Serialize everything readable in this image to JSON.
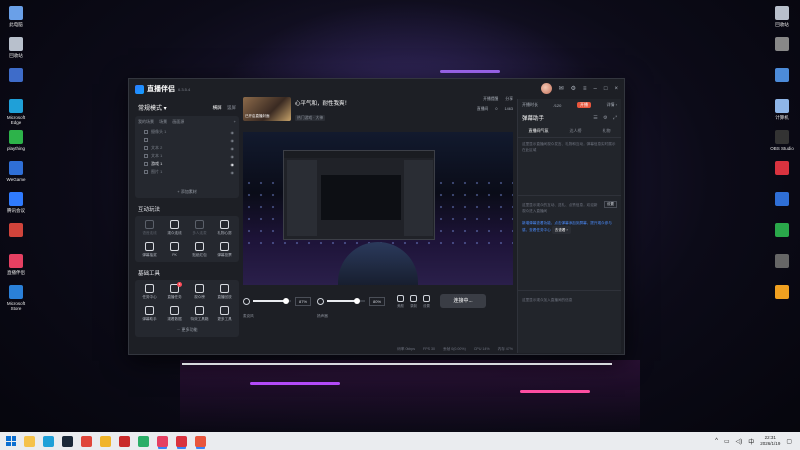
{
  "desktop": {
    "icons_left": [
      {
        "label": "此电脑",
        "color": "#6aa0e8"
      },
      {
        "label": "回收站",
        "color": "#b8c0cc"
      },
      {
        "label": "",
        "color": "#3e6cc9"
      },
      {
        "label": "Microsoft Edge",
        "color": "#1fa0d8"
      },
      {
        "label": "plaything",
        "color": "#2db34a"
      },
      {
        "label": "WeGame",
        "color": "#2f6fd6"
      },
      {
        "label": "腾讯会议",
        "color": "#2f7bff"
      },
      {
        "label": "",
        "color": "#d0443b"
      },
      {
        "label": "直播伴侣",
        "color": "#e54062"
      },
      {
        "label": "Microsoft Store",
        "color": "#2a80d8"
      }
    ],
    "icons_right": [
      {
        "label": "回收站",
        "color": "#b8c0cc"
      },
      {
        "label": "",
        "color": "#888"
      },
      {
        "label": "",
        "color": "#4c8bd9"
      },
      {
        "label": "计算机",
        "color": "#8fb6e8"
      },
      {
        "label": "OBS Studio",
        "color": "#333"
      },
      {
        "label": "",
        "color": "#d9333f"
      },
      {
        "label": "",
        "color": "#2f6fd6"
      },
      {
        "label": "",
        "color": "#2aa84a"
      },
      {
        "label": "",
        "color": "#666"
      },
      {
        "label": "",
        "color": "#f0a020"
      }
    ]
  },
  "app": {
    "name": "直播伴侣",
    "version": "6.3.5.4"
  },
  "left_panel": {
    "mode_title": "常规模式 ▾",
    "mode_tabs": [
      "横屏",
      "竖屏"
    ],
    "scene_tabs": [
      "我的场景",
      "场景",
      "画面源"
    ],
    "sources": [
      "摄像头 1",
      "",
      "文本 2",
      "文本 1",
      "游戏 1",
      "图片 1"
    ],
    "add_source": "+ 添加素材",
    "interact_title": "互动玩法",
    "interact_tools": [
      {
        "label": "语音连线",
        "dim": true
      },
      {
        "label": "观众连线",
        "dim": false
      },
      {
        "label": "多人连麦",
        "dim": true
      },
      {
        "label": "礼物心愿",
        "dim": false
      },
      {
        "label": "弹幕抽奖",
        "dim": false
      },
      {
        "label": "PK",
        "dim": false
      },
      {
        "label": "贴纸红包",
        "dim": false
      },
      {
        "label": "弹幕投票",
        "dim": false
      }
    ],
    "basic_title": "基础工具",
    "basic_tools": [
      {
        "label": "任务中心",
        "badge": ""
      },
      {
        "label": "直播任务",
        "badge": "1"
      },
      {
        "label": "观众榜",
        "badge": ""
      },
      {
        "label": "直播回放",
        "badge": ""
      },
      {
        "label": "弹幕助手",
        "badge": ""
      },
      {
        "label": "观看数据",
        "badge": ""
      },
      {
        "label": "特效工具箱",
        "badge": ""
      },
      {
        "label": "更多工具",
        "badge": ""
      }
    ],
    "more": "··· 更多功能"
  },
  "center": {
    "cover_text": "已开启直播封面",
    "stream_title": "心平气和，耐性我爽！",
    "category": "热门游戏 · 大神",
    "side_top": [
      "开播提醒",
      "分享"
    ],
    "side_bottom": [
      "直播间",
      "0",
      "1463"
    ],
    "audio": {
      "mic_label": "麦克风",
      "mic_pct": "87%",
      "mic_level": 0.87,
      "spk_label": "扬声器",
      "spk_pct": "80%",
      "spk_level": 0.8,
      "mini_buttons": [
        "美颜",
        "录制",
        "设置"
      ],
      "go_button": "连接中..."
    },
    "status": [
      "码率 0kbps",
      "FPS 30",
      "丢帧 0(0.00%)",
      "CPU 14%",
      "内存 47%"
    ]
  },
  "titlebar": {
    "right_items": [
      "开播时长",
      "/120",
      "开播",
      "详情 ›"
    ]
  },
  "right_panel": {
    "title": "弹幕助手",
    "tabs": [
      "直播间气氛",
      "达人榜",
      "礼物"
    ],
    "text1": "这里显示直播间观众发言、礼物和互动，弹幕信息实时展示在此区域",
    "text2": "这里显示观众的互动、送礼、点赞信息，欢迎新观众进入直播间",
    "small_btn": "设置",
    "blue_text": "新增弹幕查看功能，点击弹幕添加到屏幕，提升观众参与感，查看任务中心",
    "cta": "去查看 ›",
    "bottom_text": "这里显示观众加入直播间的信息"
  },
  "taskbar": {
    "apps": [
      {
        "name": "file-explorer",
        "color": "#f5c24a"
      },
      {
        "name": "edge",
        "color": "#1fa0d8"
      },
      {
        "name": "steam",
        "color": "#1b2838"
      },
      {
        "name": "chrome",
        "color": "#e0463a"
      },
      {
        "name": "app-yellow",
        "color": "#f0b429"
      },
      {
        "name": "app-red",
        "color": "#c92a2a"
      },
      {
        "name": "wechat",
        "color": "#2aae67"
      },
      {
        "name": "douyin-live",
        "color": "#e54062"
      },
      {
        "name": "app-red2",
        "color": "#d9333f"
      },
      {
        "name": "app-red3",
        "color": "#e8563d"
      }
    ],
    "time": "22:31",
    "date": "2026/1/19"
  }
}
